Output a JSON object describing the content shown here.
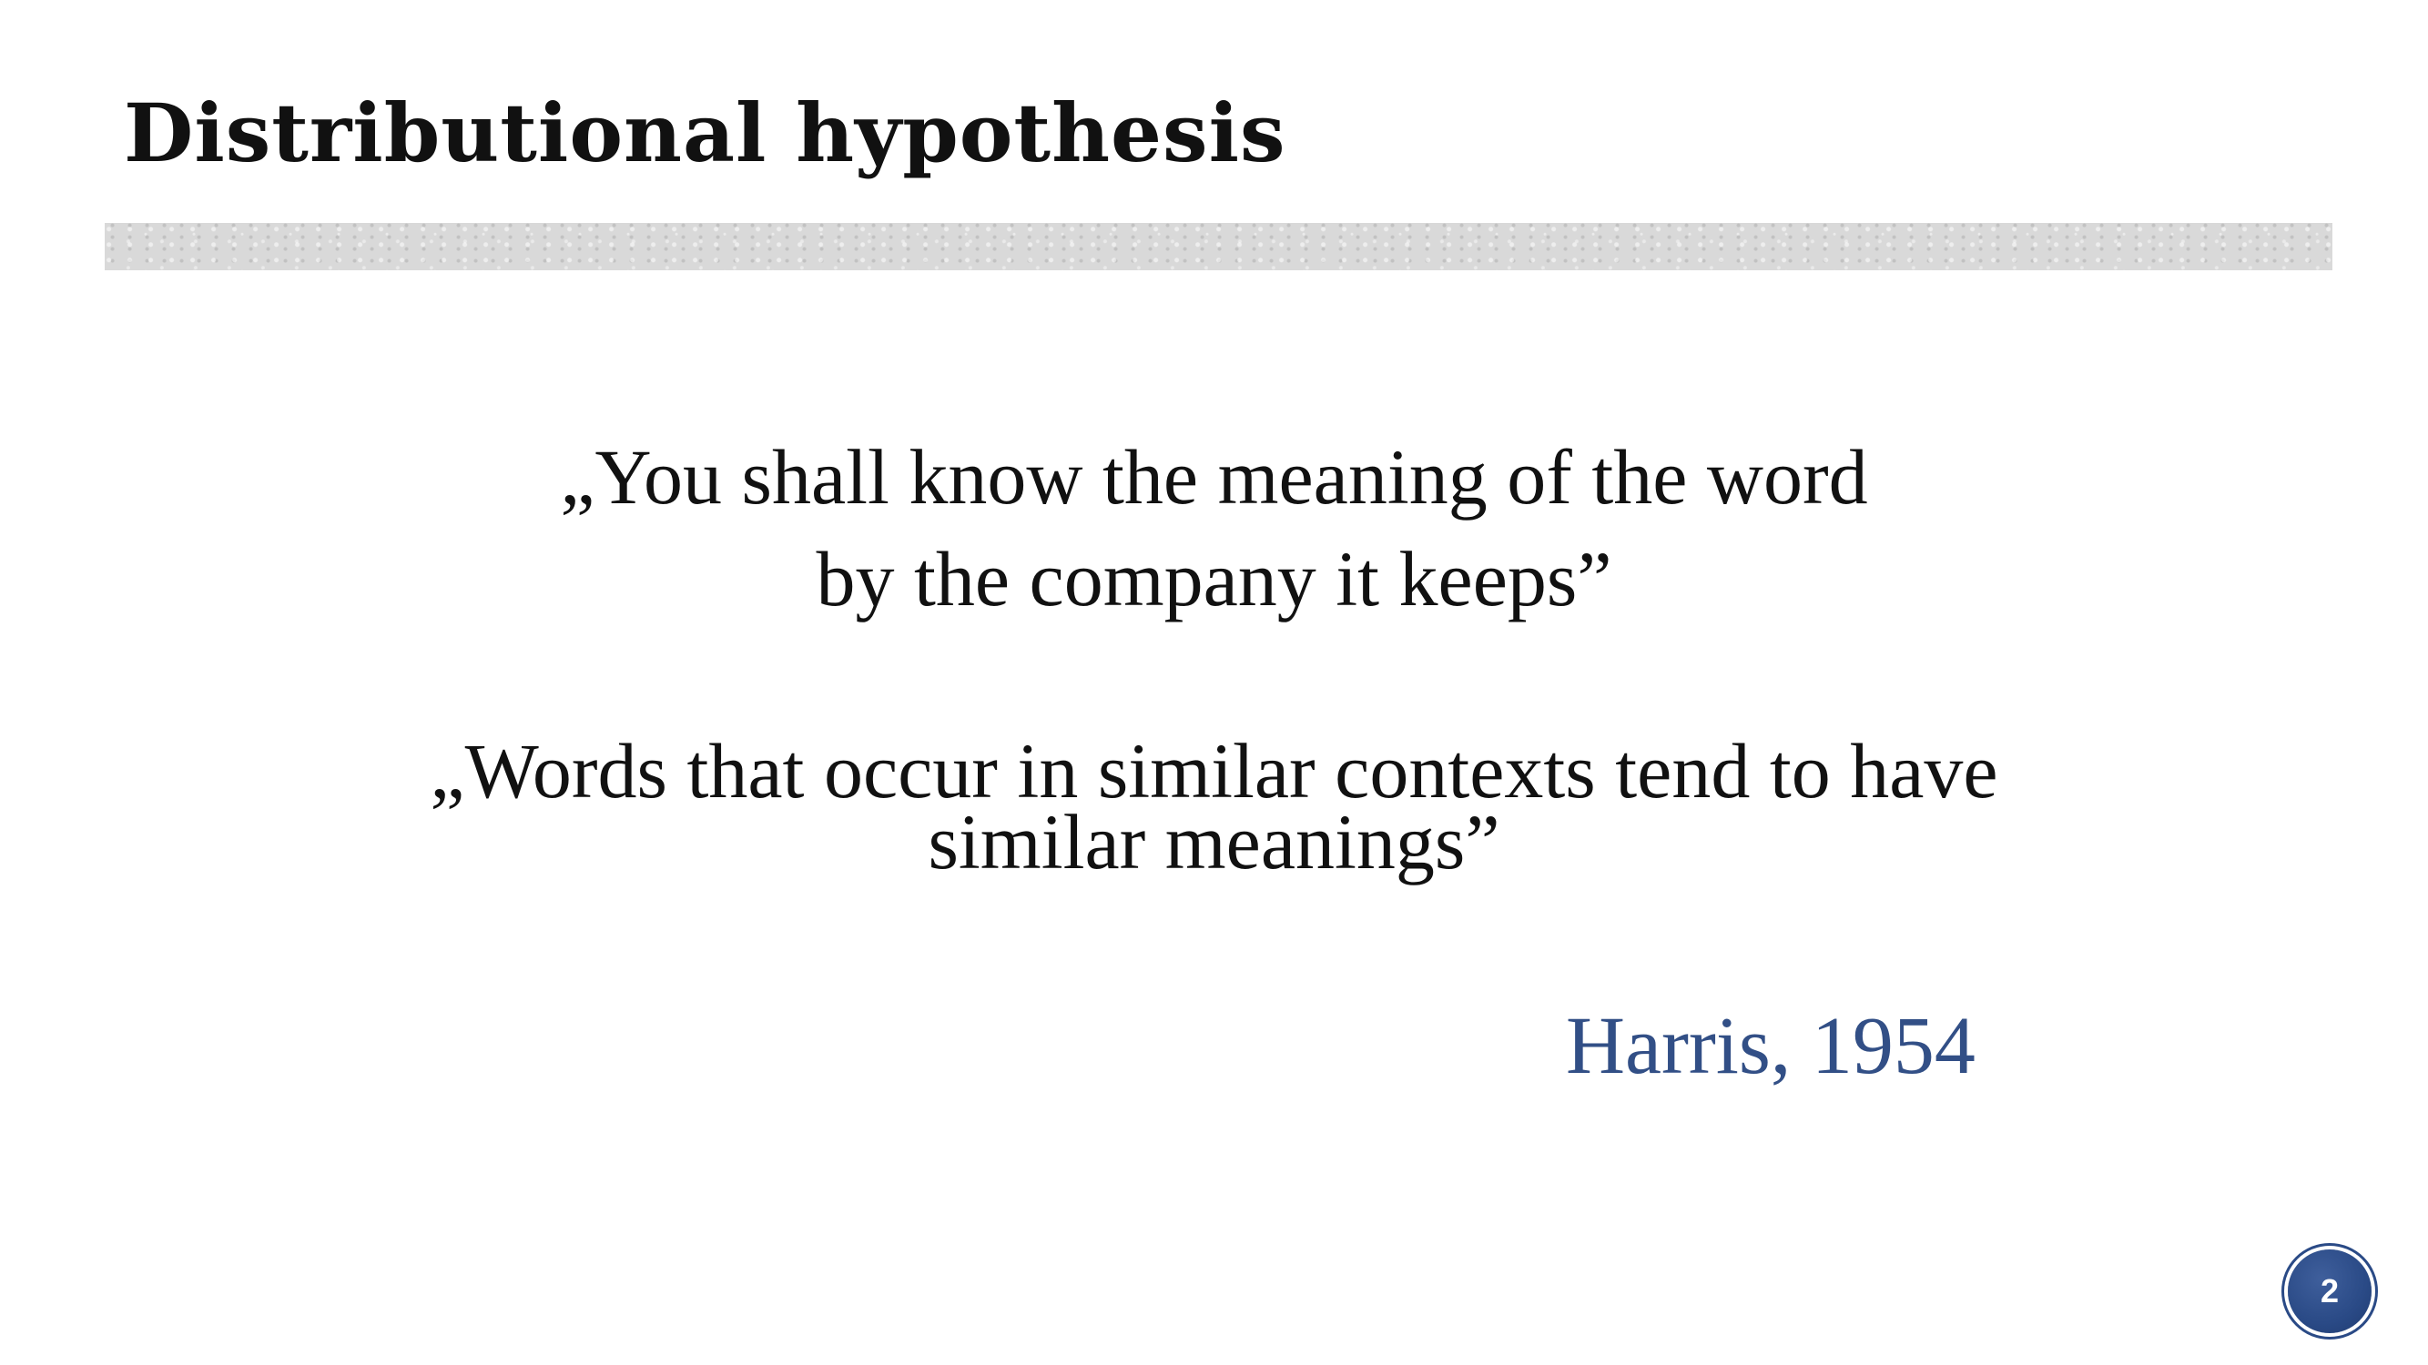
{
  "slide": {
    "title": "Distributional hypothesis",
    "quote_1": {
      "line_1": "„You shall know the meaning of the word",
      "line_2": "by the company it keeps”"
    },
    "quote_2": {
      "line_1": "„Words that occur in similar contexts tend to have",
      "line_2": "similar meanings”"
    },
    "attribution": "Harris, 1954",
    "page_number": "2"
  },
  "colors": {
    "title_text": "#111111",
    "body_text": "#111111",
    "attribution_text": "#324f86",
    "title_bar": "#d9d9d9",
    "page_badge": "#2a4a86"
  }
}
